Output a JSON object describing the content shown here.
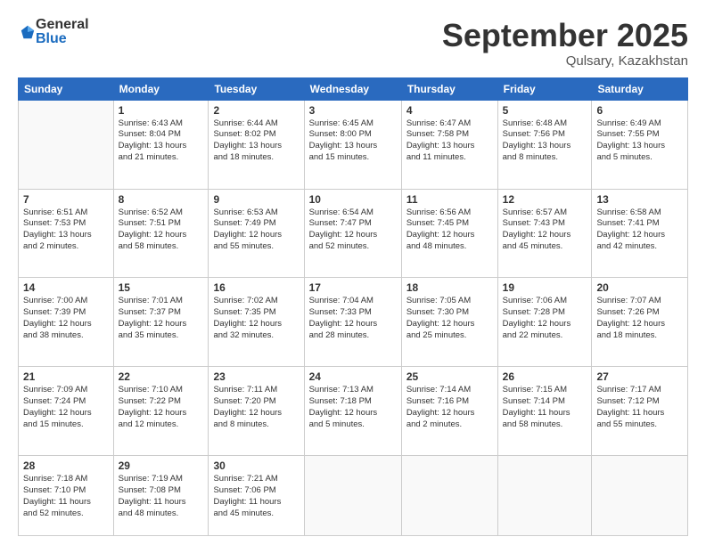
{
  "header": {
    "logo_general": "General",
    "logo_blue": "Blue",
    "month_title": "September 2025",
    "location": "Qulsary, Kazakhstan"
  },
  "days_of_week": [
    "Sunday",
    "Monday",
    "Tuesday",
    "Wednesday",
    "Thursday",
    "Friday",
    "Saturday"
  ],
  "weeks": [
    [
      {
        "day": "",
        "content": ""
      },
      {
        "day": "1",
        "content": "Sunrise: 6:43 AM\nSunset: 8:04 PM\nDaylight: 13 hours\nand 21 minutes."
      },
      {
        "day": "2",
        "content": "Sunrise: 6:44 AM\nSunset: 8:02 PM\nDaylight: 13 hours\nand 18 minutes."
      },
      {
        "day": "3",
        "content": "Sunrise: 6:45 AM\nSunset: 8:00 PM\nDaylight: 13 hours\nand 15 minutes."
      },
      {
        "day": "4",
        "content": "Sunrise: 6:47 AM\nSunset: 7:58 PM\nDaylight: 13 hours\nand 11 minutes."
      },
      {
        "day": "5",
        "content": "Sunrise: 6:48 AM\nSunset: 7:56 PM\nDaylight: 13 hours\nand 8 minutes."
      },
      {
        "day": "6",
        "content": "Sunrise: 6:49 AM\nSunset: 7:55 PM\nDaylight: 13 hours\nand 5 minutes."
      }
    ],
    [
      {
        "day": "7",
        "content": "Sunrise: 6:51 AM\nSunset: 7:53 PM\nDaylight: 13 hours\nand 2 minutes."
      },
      {
        "day": "8",
        "content": "Sunrise: 6:52 AM\nSunset: 7:51 PM\nDaylight: 12 hours\nand 58 minutes."
      },
      {
        "day": "9",
        "content": "Sunrise: 6:53 AM\nSunset: 7:49 PM\nDaylight: 12 hours\nand 55 minutes."
      },
      {
        "day": "10",
        "content": "Sunrise: 6:54 AM\nSunset: 7:47 PM\nDaylight: 12 hours\nand 52 minutes."
      },
      {
        "day": "11",
        "content": "Sunrise: 6:56 AM\nSunset: 7:45 PM\nDaylight: 12 hours\nand 48 minutes."
      },
      {
        "day": "12",
        "content": "Sunrise: 6:57 AM\nSunset: 7:43 PM\nDaylight: 12 hours\nand 45 minutes."
      },
      {
        "day": "13",
        "content": "Sunrise: 6:58 AM\nSunset: 7:41 PM\nDaylight: 12 hours\nand 42 minutes."
      }
    ],
    [
      {
        "day": "14",
        "content": "Sunrise: 7:00 AM\nSunset: 7:39 PM\nDaylight: 12 hours\nand 38 minutes."
      },
      {
        "day": "15",
        "content": "Sunrise: 7:01 AM\nSunset: 7:37 PM\nDaylight: 12 hours\nand 35 minutes."
      },
      {
        "day": "16",
        "content": "Sunrise: 7:02 AM\nSunset: 7:35 PM\nDaylight: 12 hours\nand 32 minutes."
      },
      {
        "day": "17",
        "content": "Sunrise: 7:04 AM\nSunset: 7:33 PM\nDaylight: 12 hours\nand 28 minutes."
      },
      {
        "day": "18",
        "content": "Sunrise: 7:05 AM\nSunset: 7:30 PM\nDaylight: 12 hours\nand 25 minutes."
      },
      {
        "day": "19",
        "content": "Sunrise: 7:06 AM\nSunset: 7:28 PM\nDaylight: 12 hours\nand 22 minutes."
      },
      {
        "day": "20",
        "content": "Sunrise: 7:07 AM\nSunset: 7:26 PM\nDaylight: 12 hours\nand 18 minutes."
      }
    ],
    [
      {
        "day": "21",
        "content": "Sunrise: 7:09 AM\nSunset: 7:24 PM\nDaylight: 12 hours\nand 15 minutes."
      },
      {
        "day": "22",
        "content": "Sunrise: 7:10 AM\nSunset: 7:22 PM\nDaylight: 12 hours\nand 12 minutes."
      },
      {
        "day": "23",
        "content": "Sunrise: 7:11 AM\nSunset: 7:20 PM\nDaylight: 12 hours\nand 8 minutes."
      },
      {
        "day": "24",
        "content": "Sunrise: 7:13 AM\nSunset: 7:18 PM\nDaylight: 12 hours\nand 5 minutes."
      },
      {
        "day": "25",
        "content": "Sunrise: 7:14 AM\nSunset: 7:16 PM\nDaylight: 12 hours\nand 2 minutes."
      },
      {
        "day": "26",
        "content": "Sunrise: 7:15 AM\nSunset: 7:14 PM\nDaylight: 11 hours\nand 58 minutes."
      },
      {
        "day": "27",
        "content": "Sunrise: 7:17 AM\nSunset: 7:12 PM\nDaylight: 11 hours\nand 55 minutes."
      }
    ],
    [
      {
        "day": "28",
        "content": "Sunrise: 7:18 AM\nSunset: 7:10 PM\nDaylight: 11 hours\nand 52 minutes."
      },
      {
        "day": "29",
        "content": "Sunrise: 7:19 AM\nSunset: 7:08 PM\nDaylight: 11 hours\nand 48 minutes."
      },
      {
        "day": "30",
        "content": "Sunrise: 7:21 AM\nSunset: 7:06 PM\nDaylight: 11 hours\nand 45 minutes."
      },
      {
        "day": "",
        "content": ""
      },
      {
        "day": "",
        "content": ""
      },
      {
        "day": "",
        "content": ""
      },
      {
        "day": "",
        "content": ""
      }
    ]
  ]
}
